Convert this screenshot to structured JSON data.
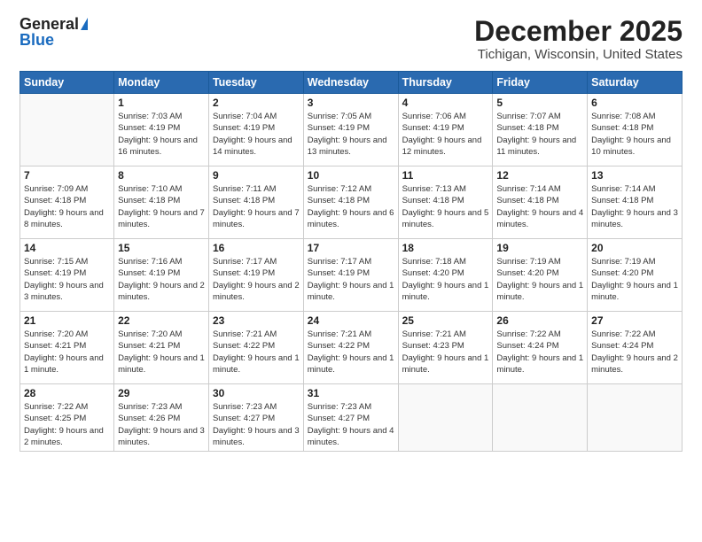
{
  "header": {
    "logo_general": "General",
    "logo_blue": "Blue",
    "title": "December 2025",
    "subtitle": "Tichigan, Wisconsin, United States"
  },
  "days_of_week": [
    "Sunday",
    "Monday",
    "Tuesday",
    "Wednesday",
    "Thursday",
    "Friday",
    "Saturday"
  ],
  "weeks": [
    [
      {
        "day": "",
        "sunrise": "",
        "sunset": "",
        "daylight": ""
      },
      {
        "day": "1",
        "sunrise": "7:03 AM",
        "sunset": "4:19 PM",
        "daylight": "9 hours and 16 minutes."
      },
      {
        "day": "2",
        "sunrise": "7:04 AM",
        "sunset": "4:19 PM",
        "daylight": "9 hours and 14 minutes."
      },
      {
        "day": "3",
        "sunrise": "7:05 AM",
        "sunset": "4:19 PM",
        "daylight": "9 hours and 13 minutes."
      },
      {
        "day": "4",
        "sunrise": "7:06 AM",
        "sunset": "4:19 PM",
        "daylight": "9 hours and 12 minutes."
      },
      {
        "day": "5",
        "sunrise": "7:07 AM",
        "sunset": "4:18 PM",
        "daylight": "9 hours and 11 minutes."
      },
      {
        "day": "6",
        "sunrise": "7:08 AM",
        "sunset": "4:18 PM",
        "daylight": "9 hours and 10 minutes."
      }
    ],
    [
      {
        "day": "7",
        "sunrise": "7:09 AM",
        "sunset": "4:18 PM",
        "daylight": "9 hours and 8 minutes."
      },
      {
        "day": "8",
        "sunrise": "7:10 AM",
        "sunset": "4:18 PM",
        "daylight": "9 hours and 7 minutes."
      },
      {
        "day": "9",
        "sunrise": "7:11 AM",
        "sunset": "4:18 PM",
        "daylight": "9 hours and 7 minutes."
      },
      {
        "day": "10",
        "sunrise": "7:12 AM",
        "sunset": "4:18 PM",
        "daylight": "9 hours and 6 minutes."
      },
      {
        "day": "11",
        "sunrise": "7:13 AM",
        "sunset": "4:18 PM",
        "daylight": "9 hours and 5 minutes."
      },
      {
        "day": "12",
        "sunrise": "7:14 AM",
        "sunset": "4:18 PM",
        "daylight": "9 hours and 4 minutes."
      },
      {
        "day": "13",
        "sunrise": "7:14 AM",
        "sunset": "4:18 PM",
        "daylight": "9 hours and 3 minutes."
      }
    ],
    [
      {
        "day": "14",
        "sunrise": "7:15 AM",
        "sunset": "4:19 PM",
        "daylight": "9 hours and 3 minutes."
      },
      {
        "day": "15",
        "sunrise": "7:16 AM",
        "sunset": "4:19 PM",
        "daylight": "9 hours and 2 minutes."
      },
      {
        "day": "16",
        "sunrise": "7:17 AM",
        "sunset": "4:19 PM",
        "daylight": "9 hours and 2 minutes."
      },
      {
        "day": "17",
        "sunrise": "7:17 AM",
        "sunset": "4:19 PM",
        "daylight": "9 hours and 1 minute."
      },
      {
        "day": "18",
        "sunrise": "7:18 AM",
        "sunset": "4:20 PM",
        "daylight": "9 hours and 1 minute."
      },
      {
        "day": "19",
        "sunrise": "7:19 AM",
        "sunset": "4:20 PM",
        "daylight": "9 hours and 1 minute."
      },
      {
        "day": "20",
        "sunrise": "7:19 AM",
        "sunset": "4:20 PM",
        "daylight": "9 hours and 1 minute."
      }
    ],
    [
      {
        "day": "21",
        "sunrise": "7:20 AM",
        "sunset": "4:21 PM",
        "daylight": "9 hours and 1 minute."
      },
      {
        "day": "22",
        "sunrise": "7:20 AM",
        "sunset": "4:21 PM",
        "daylight": "9 hours and 1 minute."
      },
      {
        "day": "23",
        "sunrise": "7:21 AM",
        "sunset": "4:22 PM",
        "daylight": "9 hours and 1 minute."
      },
      {
        "day": "24",
        "sunrise": "7:21 AM",
        "sunset": "4:22 PM",
        "daylight": "9 hours and 1 minute."
      },
      {
        "day": "25",
        "sunrise": "7:21 AM",
        "sunset": "4:23 PM",
        "daylight": "9 hours and 1 minute."
      },
      {
        "day": "26",
        "sunrise": "7:22 AM",
        "sunset": "4:24 PM",
        "daylight": "9 hours and 1 minute."
      },
      {
        "day": "27",
        "sunrise": "7:22 AM",
        "sunset": "4:24 PM",
        "daylight": "9 hours and 2 minutes."
      }
    ],
    [
      {
        "day": "28",
        "sunrise": "7:22 AM",
        "sunset": "4:25 PM",
        "daylight": "9 hours and 2 minutes."
      },
      {
        "day": "29",
        "sunrise": "7:23 AM",
        "sunset": "4:26 PM",
        "daylight": "9 hours and 3 minutes."
      },
      {
        "day": "30",
        "sunrise": "7:23 AM",
        "sunset": "4:27 PM",
        "daylight": "9 hours and 3 minutes."
      },
      {
        "day": "31",
        "sunrise": "7:23 AM",
        "sunset": "4:27 PM",
        "daylight": "9 hours and 4 minutes."
      },
      {
        "day": "",
        "sunrise": "",
        "sunset": "",
        "daylight": ""
      },
      {
        "day": "",
        "sunrise": "",
        "sunset": "",
        "daylight": ""
      },
      {
        "day": "",
        "sunrise": "",
        "sunset": "",
        "daylight": ""
      }
    ]
  ],
  "labels": {
    "sunrise_prefix": "Sunrise: ",
    "sunset_prefix": "Sunset: ",
    "daylight_prefix": "Daylight: "
  }
}
